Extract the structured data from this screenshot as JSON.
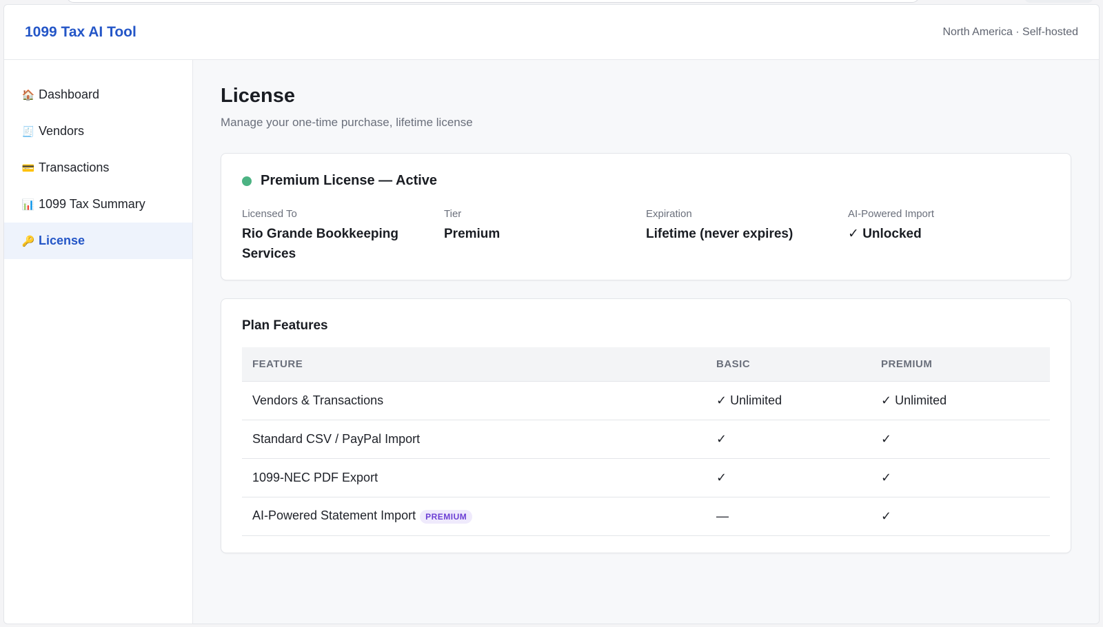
{
  "header": {
    "brand": "1099 Tax AI Tool",
    "region": "North America · Self-hosted"
  },
  "sidebar": {
    "items": [
      {
        "icon": "🏠",
        "icon_name": "house-icon",
        "label": "Dashboard"
      },
      {
        "icon": "🧾",
        "icon_name": "receipt-icon",
        "label": "Vendors"
      },
      {
        "icon": "💳",
        "icon_name": "credit-card-icon",
        "label": "Transactions"
      },
      {
        "icon": "📊",
        "icon_name": "bar-chart-icon",
        "label": "1099 Tax Summary"
      },
      {
        "icon": "🔑",
        "icon_name": "key-icon",
        "label": "License"
      }
    ],
    "active_index": 4
  },
  "page": {
    "title": "License",
    "subtitle": "Manage your one-time purchase, lifetime license"
  },
  "status": {
    "title": "Premium License — Active",
    "status_color": "#4cb383",
    "fields": [
      {
        "label": "Licensed To",
        "value": "Rio Grande Bookkeeping Services"
      },
      {
        "label": "Tier",
        "value": "Premium"
      },
      {
        "label": "Expiration",
        "value": "Lifetime (never expires)"
      },
      {
        "label": "AI-Powered Import",
        "value": "✓ Unlocked"
      }
    ]
  },
  "features": {
    "title": "Plan Features",
    "headers": [
      "FEATURE",
      "BASIC",
      "PREMIUM"
    ],
    "rows": [
      {
        "feature": "Vendors & Transactions",
        "badge": "",
        "basic": "✓ Unlimited",
        "premium": "✓ Unlimited"
      },
      {
        "feature": "Standard CSV / PayPal Import",
        "badge": "",
        "basic": "✓",
        "premium": "✓"
      },
      {
        "feature": "1099-NEC PDF Export",
        "badge": "",
        "basic": "✓",
        "premium": "✓"
      },
      {
        "feature": "AI-Powered Statement Import",
        "badge": "PREMIUM",
        "basic": "—",
        "premium": "✓"
      }
    ]
  },
  "colors": {
    "accent": "#2456c7",
    "badge_text": "#6c3fd4",
    "badge_bg": "#efeafc"
  }
}
